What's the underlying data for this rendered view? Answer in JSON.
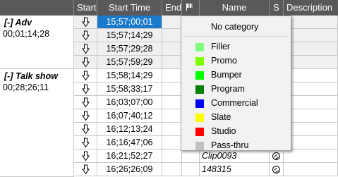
{
  "columns": {
    "start": "Start",
    "start_time": "Start Time",
    "end": "End",
    "name": "Name",
    "s": "S",
    "description": "Description"
  },
  "groups": [
    {
      "title": "[-] Adv",
      "duration": "00;01;14;28"
    },
    {
      "title": "[-] Talk show",
      "duration": "00;28;26;11"
    }
  ],
  "rows": [
    {
      "start_time": "15;57;00;01",
      "name": "",
      "selected": true
    },
    {
      "start_time": "15;57;14;29",
      "name": ""
    },
    {
      "start_time": "15;57;29;28",
      "name": ""
    },
    {
      "start_time": "15;57;59;29",
      "name": ""
    },
    {
      "start_time": "15;58;14;29",
      "name": ""
    },
    {
      "start_time": "15;58;33;17",
      "name": ""
    },
    {
      "start_time": "16;03;07;00",
      "name": ""
    },
    {
      "start_time": "16;07;40;12",
      "name": ""
    },
    {
      "start_time": "16;12;13;24",
      "name": ""
    },
    {
      "start_time": "16;16;47;06",
      "name": ""
    },
    {
      "start_time": "16;21;52;27",
      "name": "Clip0093"
    },
    {
      "start_time": "16;26;26;09",
      "name": "148315"
    }
  ],
  "category_menu": {
    "no_category": "No category",
    "items": [
      {
        "label": "Filler",
        "color": "#80ff80"
      },
      {
        "label": "Promo",
        "color": "#80ff00"
      },
      {
        "label": "Bumper",
        "color": "#00ff00"
      },
      {
        "label": "Program",
        "color": "#008000"
      },
      {
        "label": "Commercial",
        "color": "#0000ff"
      },
      {
        "label": "Slate",
        "color": "#ffff00"
      },
      {
        "label": "Studio",
        "color": "#ff0000"
      },
      {
        "label": "Pass-thru",
        "color": "#c0c0c0"
      }
    ]
  },
  "icons": {
    "start_marker": "down-arrow-icon",
    "category_header": "flag-icon",
    "status": "link-icon"
  }
}
